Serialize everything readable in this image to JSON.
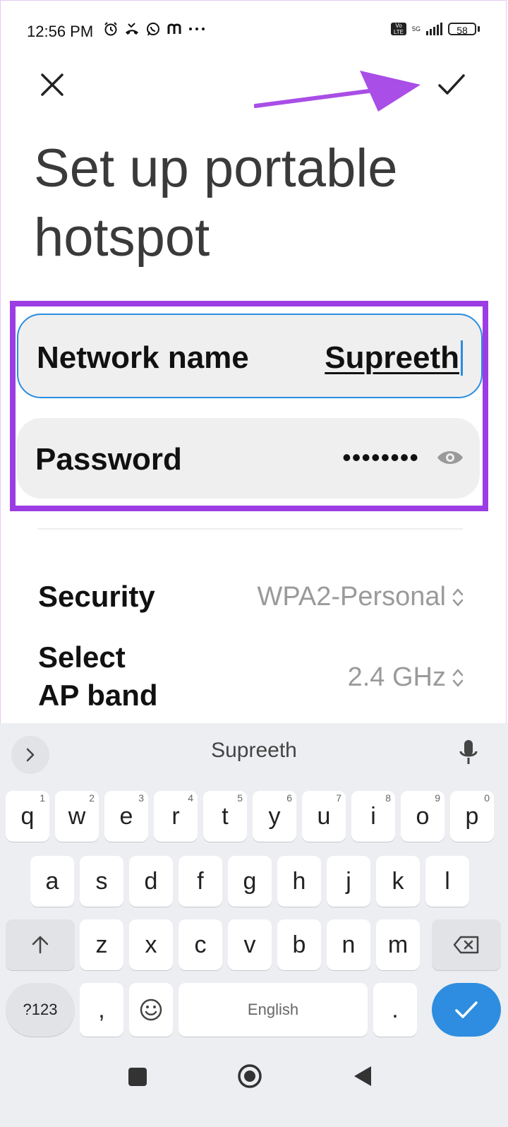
{
  "status_bar": {
    "time": "12:56 PM",
    "left_icons": [
      "alarm-icon",
      "missed-call-icon",
      "whatsapp-icon",
      "m-app-icon",
      "more-notifications-icon"
    ],
    "right_icons": [
      "volte-icon",
      "network-5g-icon",
      "signal-icon",
      "battery-icon"
    ],
    "volte_label": "Vo LTE",
    "network_label": "5G",
    "battery": "58"
  },
  "toolbar": {
    "close_icon": "close-icon",
    "confirm_icon": "checkmark-icon",
    "annotation": "purple-arrow-pointing-to-confirm"
  },
  "title": "Set up portable hotspot",
  "fields": {
    "network_name": {
      "label": "Network name",
      "value": "Supreeth"
    },
    "password": {
      "label": "Password",
      "value": "••••••••",
      "icon": "eye-icon"
    }
  },
  "settings": {
    "security": {
      "label": "Security",
      "value": "WPA2-Personal"
    },
    "ap_band": {
      "label": "Select AP band",
      "label_line1": "Select",
      "label_line2": "AP band",
      "value": "2.4 GHz"
    }
  },
  "keyboard": {
    "suggestion": "Supreeth",
    "row1": [
      "q",
      "w",
      "e",
      "r",
      "t",
      "y",
      "u",
      "i",
      "o",
      "p"
    ],
    "row1_hints": [
      "1",
      "2",
      "3",
      "4",
      "5",
      "6",
      "7",
      "8",
      "9",
      "0"
    ],
    "row2": [
      "a",
      "s",
      "d",
      "f",
      "g",
      "h",
      "j",
      "k",
      "l"
    ],
    "row3": [
      "z",
      "x",
      "c",
      "v",
      "b",
      "n",
      "m"
    ],
    "symbols_key": "?123",
    "comma_key": ",",
    "space_label": "English",
    "period_key": ".",
    "enter_icon": "checkmark-icon",
    "shift_icon": "shift-icon",
    "backspace_icon": "backspace-icon",
    "emoji_icon": "emoji-icon",
    "mic_icon": "mic-icon"
  },
  "nav_bar": [
    "recents-square-icon",
    "home-circle-icon",
    "back-triangle-icon"
  ],
  "colors": {
    "highlight": "#9b3de3",
    "focus_border": "#2a8de0",
    "enter_key": "#2e8de0",
    "keyboard_bg": "#eceef1",
    "secondary_text": "#9a9a9a"
  }
}
